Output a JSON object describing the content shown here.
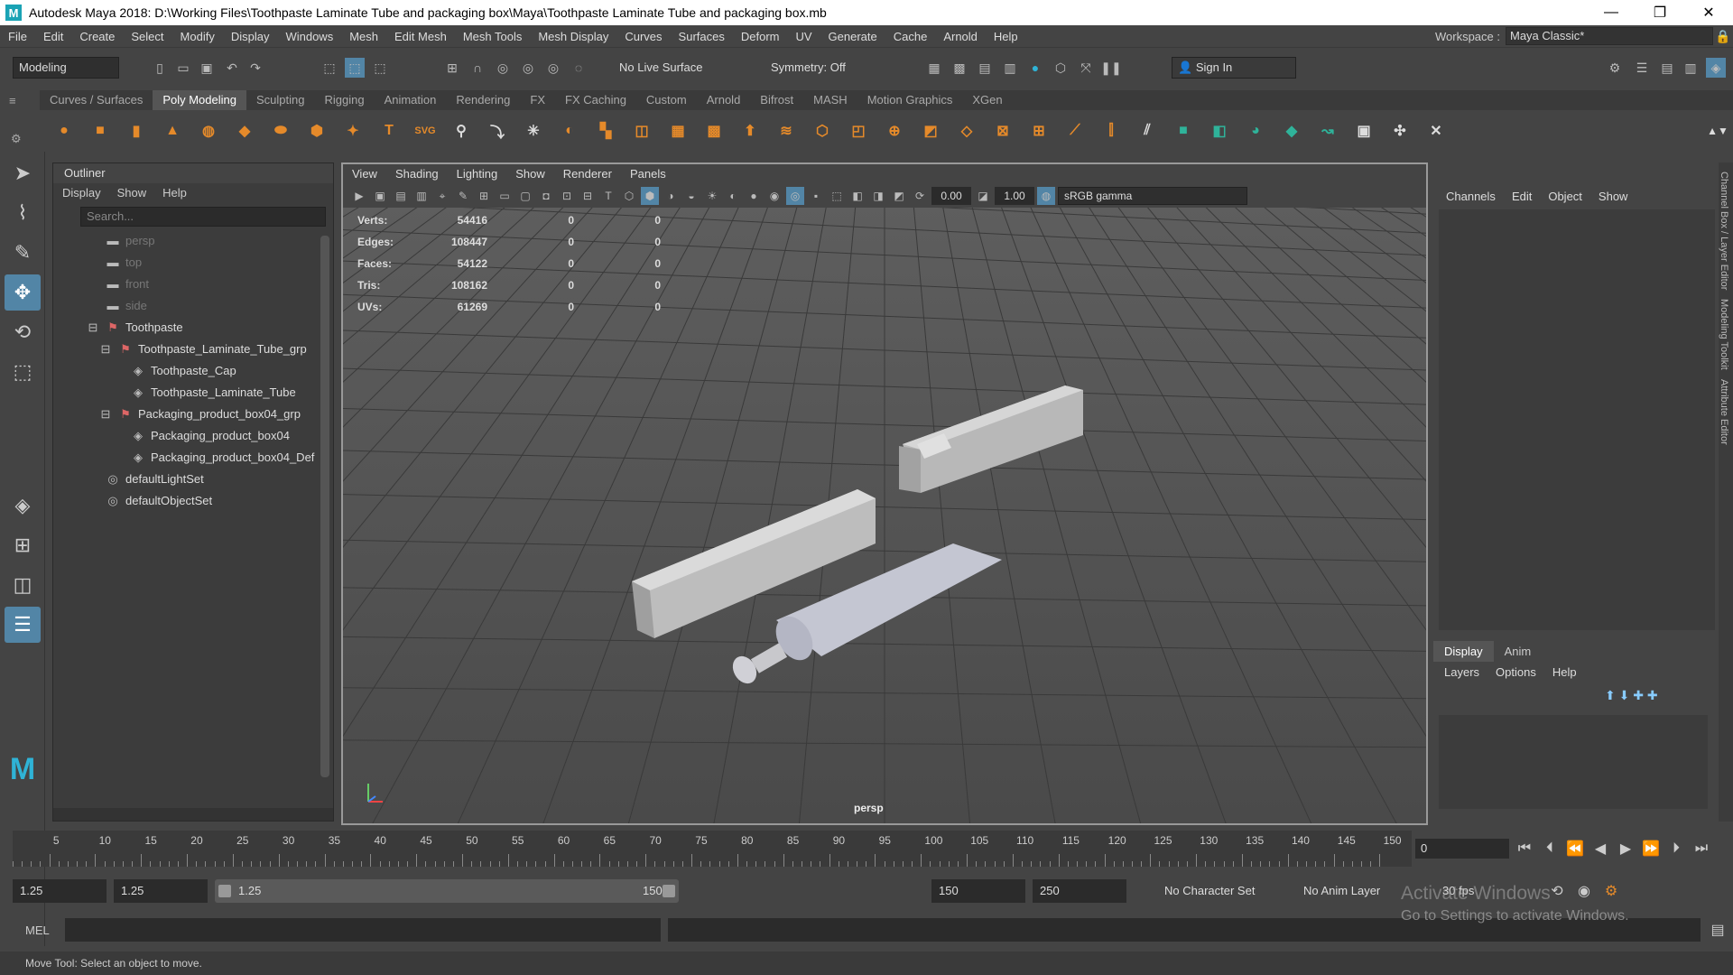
{
  "window": {
    "title": "Autodesk Maya 2018: D:\\Working Files\\Toothpaste Laminate Tube and packaging box\\Maya\\Toothpaste Laminate Tube and packaging box.mb",
    "minimize": "—",
    "maximize": "❐",
    "close": "✕"
  },
  "menu": [
    "File",
    "Edit",
    "Create",
    "Select",
    "Modify",
    "Display",
    "Windows",
    "Mesh",
    "Edit Mesh",
    "Mesh Tools",
    "Mesh Display",
    "Curves",
    "Surfaces",
    "Deform",
    "UV",
    "Generate",
    "Cache",
    "Arnold",
    "Help"
  ],
  "workspace": {
    "label": "Workspace :",
    "value": "Maya Classic*"
  },
  "status": {
    "menu_set": "Modeling",
    "live_surface": "No Live Surface",
    "symmetry": "Symmetry: Off",
    "sign_in": "Sign In"
  },
  "shelf_tabs": [
    "Curves / Surfaces",
    "Poly Modeling",
    "Sculpting",
    "Rigging",
    "Animation",
    "Rendering",
    "FX",
    "FX Caching",
    "Custom",
    "Arnold",
    "Bifrost",
    "MASH",
    "Motion Graphics",
    "XGen"
  ],
  "outliner": {
    "title": "Outliner",
    "menus": [
      "Display",
      "Show",
      "Help"
    ],
    "search_placeholder": "Search...",
    "items": [
      {
        "label": "persp",
        "type": "camera",
        "indent": 0
      },
      {
        "label": "top",
        "type": "camera",
        "indent": 0
      },
      {
        "label": "front",
        "type": "camera",
        "indent": 0
      },
      {
        "label": "side",
        "type": "camera",
        "indent": 0
      },
      {
        "label": "Toothpaste",
        "type": "group",
        "indent": 0
      },
      {
        "label": "Toothpaste_Laminate_Tube_grp",
        "type": "group",
        "indent": 1
      },
      {
        "label": "Toothpaste_Cap",
        "type": "mesh",
        "indent": 2
      },
      {
        "label": "Toothpaste_Laminate_Tube",
        "type": "mesh",
        "indent": 2
      },
      {
        "label": "Packaging_product_box04_grp",
        "type": "group",
        "indent": 1
      },
      {
        "label": "Packaging_product_box04",
        "type": "mesh",
        "indent": 2
      },
      {
        "label": "Packaging_product_box04_Def",
        "type": "mesh",
        "indent": 2
      },
      {
        "label": "defaultLightSet",
        "type": "set",
        "indent": 0
      },
      {
        "label": "defaultObjectSet",
        "type": "set",
        "indent": 0
      }
    ]
  },
  "viewport": {
    "menus": [
      "View",
      "Shading",
      "Lighting",
      "Show",
      "Renderer",
      "Panels"
    ],
    "exposure": "0.00",
    "gamma": "1.00",
    "color_space": "sRGB gamma",
    "camera": "persp",
    "hud": [
      {
        "k": "Verts:",
        "v": "54416",
        "a": "0",
        "b": "0"
      },
      {
        "k": "Edges:",
        "v": "108447",
        "a": "0",
        "b": "0"
      },
      {
        "k": "Faces:",
        "v": "54122",
        "a": "0",
        "b": "0"
      },
      {
        "k": "Tris:",
        "v": "108162",
        "a": "0",
        "b": "0"
      },
      {
        "k": "UVs:",
        "v": "61269",
        "a": "0",
        "b": "0"
      }
    ]
  },
  "channelbox": {
    "menus": [
      "Channels",
      "Edit",
      "Object",
      "Show"
    ]
  },
  "layers": {
    "tabs": [
      "Display",
      "Anim"
    ],
    "menus": [
      "Layers",
      "Options",
      "Help"
    ]
  },
  "sidetabs": [
    "Channel Box / Layer Editor",
    "Modeling Toolkit",
    "Attribute Editor"
  ],
  "timeline": {
    "ticks": [
      "5",
      "10",
      "15",
      "20",
      "25",
      "30",
      "35",
      "40",
      "45",
      "50",
      "55",
      "60",
      "65",
      "70",
      "75",
      "80",
      "85",
      "90",
      "95",
      "100",
      "105",
      "110",
      "115",
      "120",
      "125",
      "130",
      "135",
      "140",
      "145",
      "150"
    ],
    "current": "0"
  },
  "range": {
    "start": "1.25",
    "inner_start": "1.25",
    "slider_start": "1.25",
    "slider_end": "150",
    "end": "150",
    "max": "250",
    "char_set": "No Character Set",
    "anim_layer": "No Anim Layer",
    "fps": "30 fps"
  },
  "cmd": {
    "label": "MEL"
  },
  "help_line": "Move Tool: Select an object to move.",
  "watermark": {
    "line1": "Activate Windows",
    "line2": "Go to Settings to activate Windows."
  }
}
